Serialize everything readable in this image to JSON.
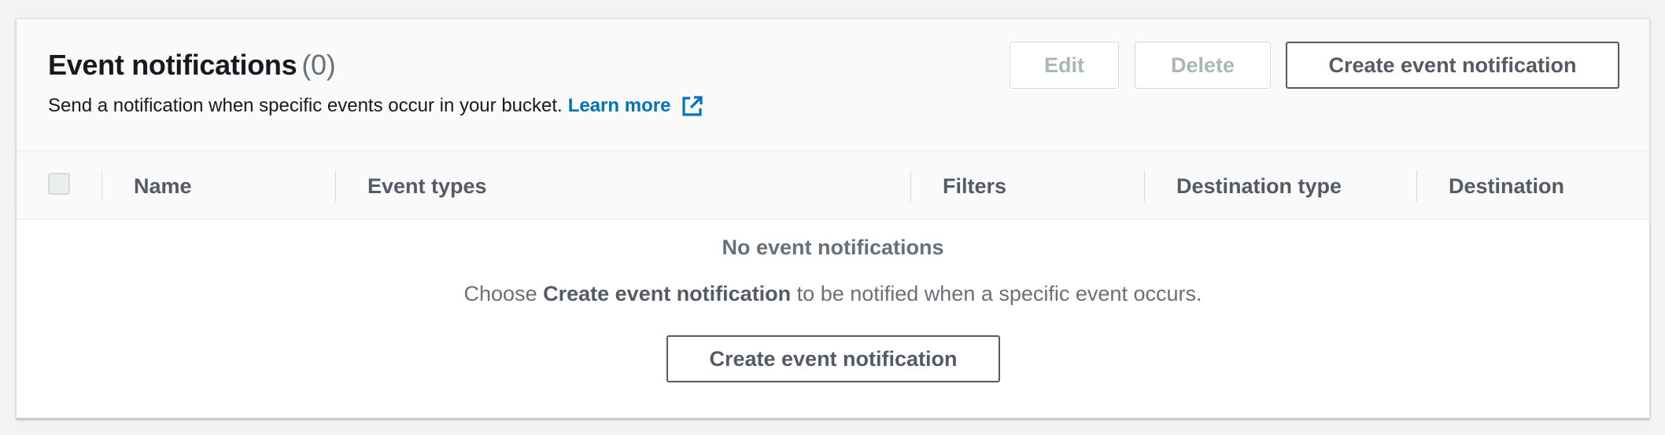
{
  "header": {
    "title": "Event notifications",
    "count": "(0)",
    "description": "Send a notification when specific events occur in your bucket.",
    "learn_more": "Learn more"
  },
  "actions": {
    "edit_label": "Edit",
    "delete_label": "Delete",
    "create_label": "Create event notification"
  },
  "table": {
    "columns": [
      "Name",
      "Event types",
      "Filters",
      "Destination type",
      "Destination"
    ]
  },
  "empty_state": {
    "title": "No event notifications",
    "text_prefix": "Choose ",
    "text_bold": "Create event notification",
    "text_suffix": " to be notified when a specific event occurs.",
    "button_label": "Create event notification"
  },
  "colors": {
    "link": "#0073bb",
    "button_border": "#545b64",
    "disabled_text": "#aab7b8"
  },
  "icons": {
    "external_link": "external-link-icon",
    "checkbox": "select-all-checkbox"
  }
}
